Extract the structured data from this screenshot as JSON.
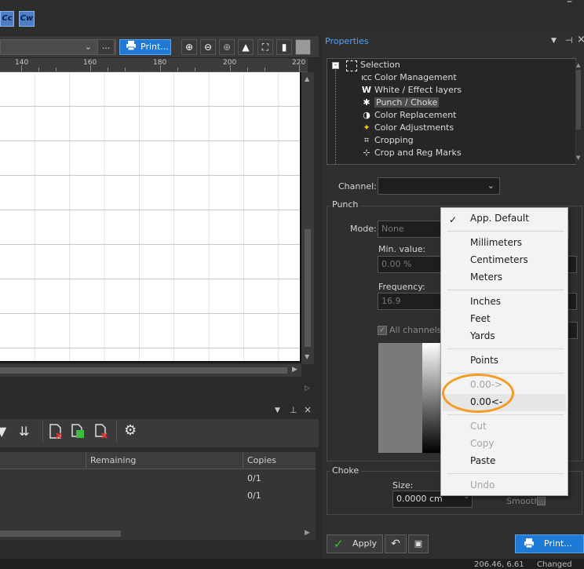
{
  "top": {
    "format_buttons": [
      "Cc",
      "Cw"
    ],
    "window_controls": [
      "–"
    ]
  },
  "toolbar": {
    "combo_value": "",
    "ellipsis_label": "...",
    "print_label": "Print..."
  },
  "ruler": {
    "labels": [
      "140",
      "160",
      "180",
      "200",
      "220"
    ]
  },
  "queue": {
    "columns": [
      "Remaining",
      "Copies"
    ],
    "rows": [
      {
        "remaining": "",
        "copies": "0/1"
      },
      {
        "remaining": "",
        "copies": "0/1"
      }
    ]
  },
  "properties": {
    "title": "Properties",
    "pin": "⊣",
    "close": "×",
    "tree": [
      {
        "icon": "selection-icon",
        "label": "Selection"
      },
      {
        "icon": "icc-icon",
        "glyph": "ICC",
        "label": "Color Management"
      },
      {
        "icon": "white-layer-icon",
        "glyph": "W",
        "label": "White / Effect layers"
      },
      {
        "icon": "punch-choke-icon",
        "glyph": "✱",
        "label": "Punch / Choke"
      },
      {
        "icon": "color-replacement-icon",
        "glyph": "◑",
        "label": "Color Replacement"
      },
      {
        "icon": "color-adjustments-icon",
        "glyph": "✦",
        "label": "Color Adjustments"
      },
      {
        "icon": "cropping-icon",
        "glyph": "⌗",
        "label": "Cropping"
      },
      {
        "icon": "crop-reg-marks-icon",
        "glyph": "⊹",
        "label": "Crop and Reg Marks"
      }
    ],
    "channel_label": "Channel:",
    "channel_value": "",
    "punch": {
      "title": "Punch",
      "mode_label": "Mode:",
      "mode_value": "None",
      "min_label": "Min. value:",
      "min_value": "0.00 %",
      "freq_label": "Frequency:",
      "freq_value": "16.9",
      "all_channels_label": "All channels"
    },
    "choke": {
      "title": "Choke",
      "size_label": "Size:",
      "size_value": "0.0000 cm",
      "smooth_label": "Smooth"
    },
    "apply_label": "Apply",
    "print_label": "Print..."
  },
  "context_menu": {
    "items": [
      {
        "label": "App. Default",
        "checked": true,
        "enabled": true
      },
      {
        "label": "Millimeters",
        "enabled": true
      },
      {
        "label": "Centimeters",
        "enabled": true
      },
      {
        "label": "Meters",
        "enabled": true
      },
      {
        "label": "Inches",
        "enabled": true
      },
      {
        "label": "Feet",
        "enabled": true
      },
      {
        "label": "Yards",
        "enabled": true
      },
      {
        "label": "Points",
        "enabled": true
      },
      {
        "label": "0.00->",
        "enabled": false
      },
      {
        "label": "0.00<-",
        "enabled": true,
        "hovered": true
      },
      {
        "label": "Cut",
        "enabled": false
      },
      {
        "label": "Copy",
        "enabled": false
      },
      {
        "label": "Paste",
        "enabled": true
      },
      {
        "label": "Undo",
        "enabled": false
      }
    ],
    "highlight_color": "#f59a23"
  },
  "status": {
    "coords": "206.46, 6.61",
    "state": "Changed"
  },
  "colors": {
    "accent": "#1f7ad6",
    "title_blue": "#4fa3ff",
    "apply_check": "#3fbf3f"
  }
}
